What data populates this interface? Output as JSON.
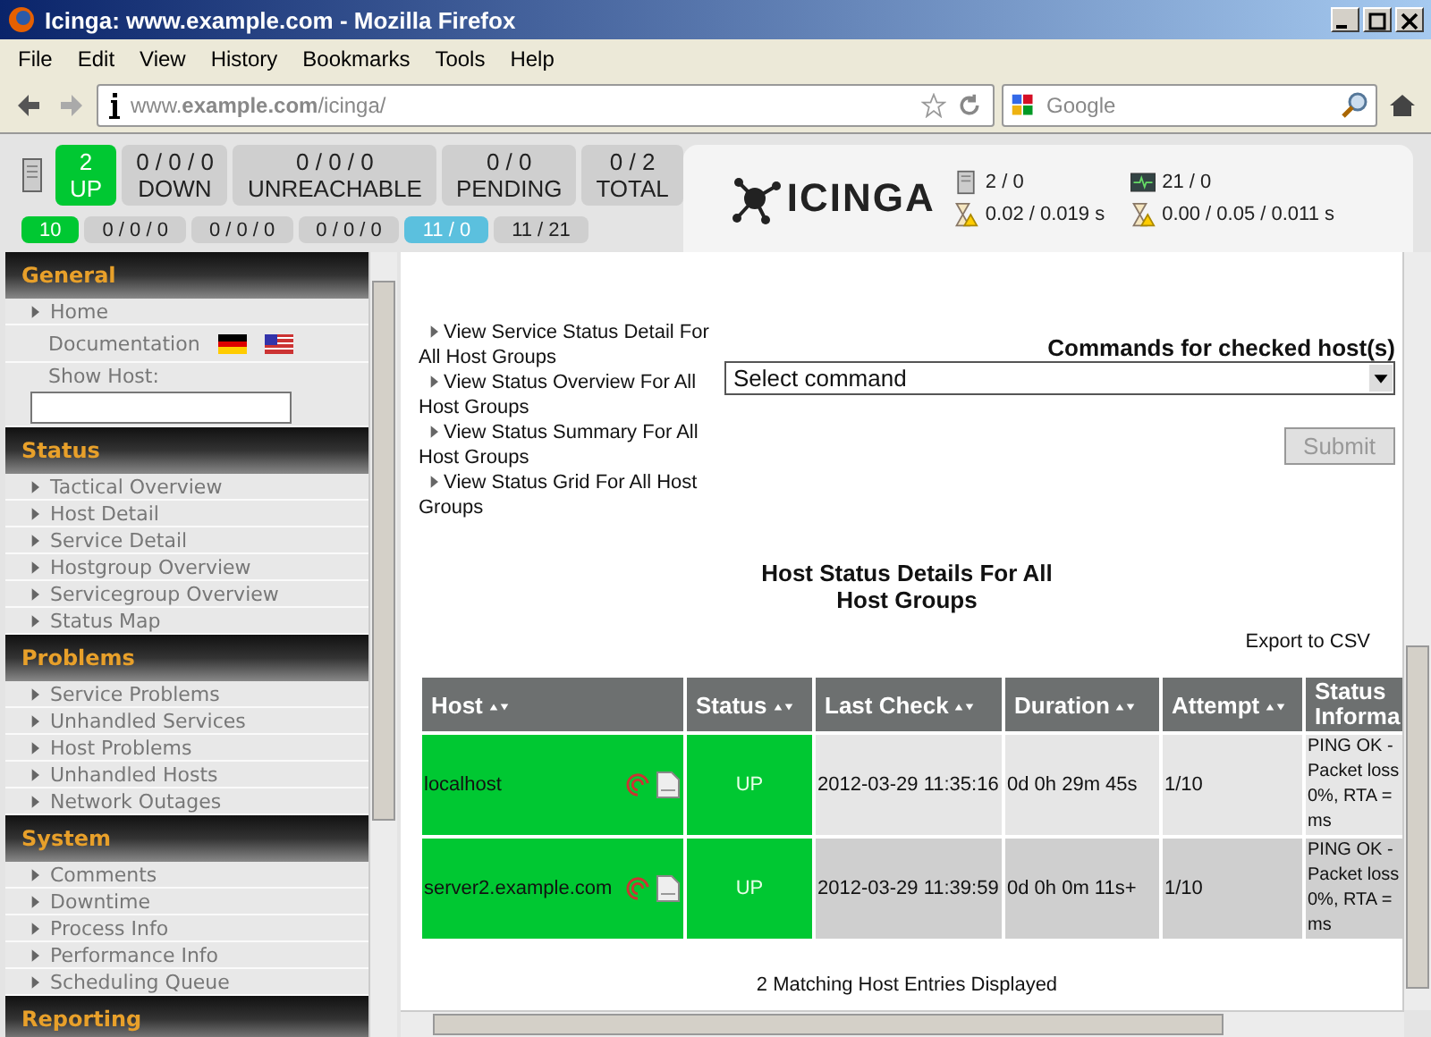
{
  "window": {
    "title": "Icinga: www.example.com - Mozilla Firefox"
  },
  "menu": [
    "File",
    "Edit",
    "View",
    "History",
    "Bookmarks",
    "Tools",
    "Help"
  ],
  "address_bar": {
    "value": "www.**example.com**/icinga/"
  },
  "search_field": {
    "placeholder": "Google"
  },
  "host_counters": [
    {
      "count": "2",
      "label": "UP",
      "kind": "up"
    },
    {
      "count": "0 / 0 / 0",
      "label": "DOWN",
      "kind": "neutral"
    },
    {
      "count": "0 / 0 / 0",
      "label": "UNREACHABLE",
      "kind": "neutral"
    },
    {
      "count": "0 / 0",
      "label": "PENDING",
      "kind": "neutral"
    },
    {
      "count": "0 / 2",
      "label": "TOTAL",
      "kind": "neutral"
    }
  ],
  "service_counters": [
    {
      "count": "10",
      "kind": "ok"
    },
    {
      "count": "0 / 0 / 0",
      "kind": "neutral"
    },
    {
      "count": "0 / 0 / 0",
      "kind": "neutral"
    },
    {
      "count": "0 / 0 / 0",
      "kind": "neutral"
    },
    {
      "count": "11 / 0",
      "kind": "info"
    },
    {
      "count": "11 / 21",
      "kind": "neutral"
    }
  ],
  "logo": {
    "text": "ICINGA"
  },
  "stats": [
    {
      "kind": "host",
      "text": "2 / 0"
    },
    {
      "kind": "service",
      "text": "21 / 0"
    },
    {
      "kind": "latency",
      "text": "0.02 / 0.019 s"
    },
    {
      "kind": "latency",
      "text": "0.00 / 0.05 / 0.011 s"
    }
  ],
  "sidebar": {
    "sections": [
      {
        "title": "General",
        "items": [
          {
            "kind": "link",
            "label": "Home"
          },
          {
            "kind": "docs",
            "label": "Documentation"
          },
          {
            "kind": "field",
            "label": "Show Host:"
          }
        ]
      },
      {
        "title": "Status",
        "items": [
          {
            "kind": "link",
            "label": "Tactical Overview"
          },
          {
            "kind": "link",
            "label": "Host Detail"
          },
          {
            "kind": "link",
            "label": "Service Detail"
          },
          {
            "kind": "link",
            "label": "Hostgroup Overview"
          },
          {
            "kind": "link",
            "label": "Servicegroup Overview"
          },
          {
            "kind": "link",
            "label": "Status Map"
          }
        ]
      },
      {
        "title": "Problems",
        "items": [
          {
            "kind": "link",
            "label": "Service Problems"
          },
          {
            "kind": "link",
            "label": "Unhandled Services"
          },
          {
            "kind": "link",
            "label": "Host Problems"
          },
          {
            "kind": "link",
            "label": "Unhandled Hosts"
          },
          {
            "kind": "link",
            "label": "Network Outages"
          }
        ]
      },
      {
        "title": "System",
        "items": [
          {
            "kind": "link",
            "label": "Comments"
          },
          {
            "kind": "link",
            "label": "Downtime"
          },
          {
            "kind": "link",
            "label": "Process Info"
          },
          {
            "kind": "link",
            "label": "Performance Info"
          },
          {
            "kind": "link",
            "label": "Scheduling Queue"
          }
        ]
      },
      {
        "title": "Reporting"
      }
    ]
  },
  "view_links": [
    "View Service Status Detail For All Host Groups",
    "View Status Overview For All Host Groups",
    "View Status Summary For All Host Groups",
    "View Status Grid For All Host Groups"
  ],
  "commands": {
    "title": "Commands for checked host(s)",
    "select": "Select command",
    "submit": {
      "label": "Submit",
      "disabled": true
    }
  },
  "page_title": "Host Status Details For All Host Groups",
  "export_link": "Export to CSV",
  "table": {
    "columns": [
      {
        "label": "Host",
        "sortable": true
      },
      {
        "label": "Status",
        "sortable": true
      },
      {
        "label": "Last Check",
        "sortable": true
      },
      {
        "label": "Duration",
        "sortable": true
      },
      {
        "label": "Attempt",
        "sortable": true
      },
      {
        "label": "Status Informa",
        "sortable": false
      }
    ],
    "rows": [
      {
        "host": "localhost",
        "status": "UP",
        "last_check": "2012-03-29 11:35:16",
        "duration": "0d 0h 29m 45s",
        "attempt": "1/10",
        "info": "PING OK - Packet loss 0%, RTA = ms"
      },
      {
        "host": "server2.example.com",
        "status": "UP",
        "last_check": "2012-03-29 11:39:59",
        "duration": "0d 0h 0m 11s+",
        "attempt": "1/10",
        "info": "PING OK - Packet loss 0%, RTA = ms"
      }
    ]
  },
  "footer": "2 Matching Host Entries Displayed"
}
